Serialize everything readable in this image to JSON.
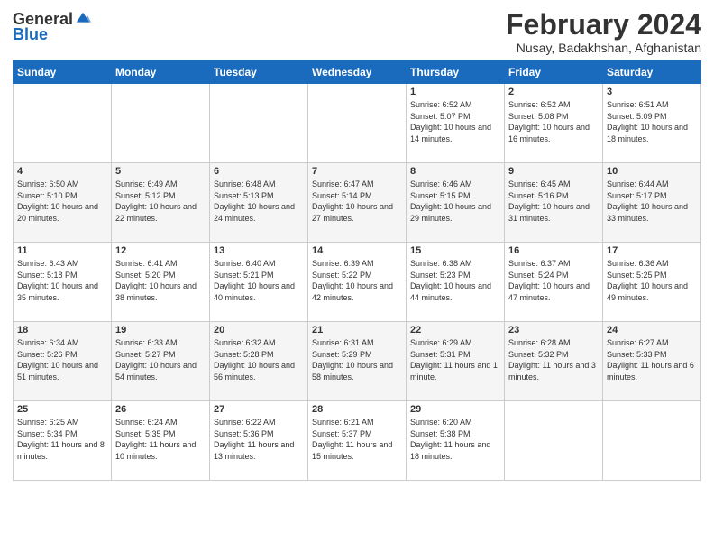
{
  "header": {
    "logo_general": "General",
    "logo_blue": "Blue",
    "month_year": "February 2024",
    "location": "Nusay, Badakhshan, Afghanistan"
  },
  "days_of_week": [
    "Sunday",
    "Monday",
    "Tuesday",
    "Wednesday",
    "Thursday",
    "Friday",
    "Saturday"
  ],
  "weeks": [
    [
      {
        "day": "",
        "info": ""
      },
      {
        "day": "",
        "info": ""
      },
      {
        "day": "",
        "info": ""
      },
      {
        "day": "",
        "info": ""
      },
      {
        "day": "1",
        "info": "Sunrise: 6:52 AM\nSunset: 5:07 PM\nDaylight: 10 hours and 14 minutes."
      },
      {
        "day": "2",
        "info": "Sunrise: 6:52 AM\nSunset: 5:08 PM\nDaylight: 10 hours and 16 minutes."
      },
      {
        "day": "3",
        "info": "Sunrise: 6:51 AM\nSunset: 5:09 PM\nDaylight: 10 hours and 18 minutes."
      }
    ],
    [
      {
        "day": "4",
        "info": "Sunrise: 6:50 AM\nSunset: 5:10 PM\nDaylight: 10 hours and 20 minutes."
      },
      {
        "day": "5",
        "info": "Sunrise: 6:49 AM\nSunset: 5:12 PM\nDaylight: 10 hours and 22 minutes."
      },
      {
        "day": "6",
        "info": "Sunrise: 6:48 AM\nSunset: 5:13 PM\nDaylight: 10 hours and 24 minutes."
      },
      {
        "day": "7",
        "info": "Sunrise: 6:47 AM\nSunset: 5:14 PM\nDaylight: 10 hours and 27 minutes."
      },
      {
        "day": "8",
        "info": "Sunrise: 6:46 AM\nSunset: 5:15 PM\nDaylight: 10 hours and 29 minutes."
      },
      {
        "day": "9",
        "info": "Sunrise: 6:45 AM\nSunset: 5:16 PM\nDaylight: 10 hours and 31 minutes."
      },
      {
        "day": "10",
        "info": "Sunrise: 6:44 AM\nSunset: 5:17 PM\nDaylight: 10 hours and 33 minutes."
      }
    ],
    [
      {
        "day": "11",
        "info": "Sunrise: 6:43 AM\nSunset: 5:18 PM\nDaylight: 10 hours and 35 minutes."
      },
      {
        "day": "12",
        "info": "Sunrise: 6:41 AM\nSunset: 5:20 PM\nDaylight: 10 hours and 38 minutes."
      },
      {
        "day": "13",
        "info": "Sunrise: 6:40 AM\nSunset: 5:21 PM\nDaylight: 10 hours and 40 minutes."
      },
      {
        "day": "14",
        "info": "Sunrise: 6:39 AM\nSunset: 5:22 PM\nDaylight: 10 hours and 42 minutes."
      },
      {
        "day": "15",
        "info": "Sunrise: 6:38 AM\nSunset: 5:23 PM\nDaylight: 10 hours and 44 minutes."
      },
      {
        "day": "16",
        "info": "Sunrise: 6:37 AM\nSunset: 5:24 PM\nDaylight: 10 hours and 47 minutes."
      },
      {
        "day": "17",
        "info": "Sunrise: 6:36 AM\nSunset: 5:25 PM\nDaylight: 10 hours and 49 minutes."
      }
    ],
    [
      {
        "day": "18",
        "info": "Sunrise: 6:34 AM\nSunset: 5:26 PM\nDaylight: 10 hours and 51 minutes."
      },
      {
        "day": "19",
        "info": "Sunrise: 6:33 AM\nSunset: 5:27 PM\nDaylight: 10 hours and 54 minutes."
      },
      {
        "day": "20",
        "info": "Sunrise: 6:32 AM\nSunset: 5:28 PM\nDaylight: 10 hours and 56 minutes."
      },
      {
        "day": "21",
        "info": "Sunrise: 6:31 AM\nSunset: 5:29 PM\nDaylight: 10 hours and 58 minutes."
      },
      {
        "day": "22",
        "info": "Sunrise: 6:29 AM\nSunset: 5:31 PM\nDaylight: 11 hours and 1 minute."
      },
      {
        "day": "23",
        "info": "Sunrise: 6:28 AM\nSunset: 5:32 PM\nDaylight: 11 hours and 3 minutes."
      },
      {
        "day": "24",
        "info": "Sunrise: 6:27 AM\nSunset: 5:33 PM\nDaylight: 11 hours and 6 minutes."
      }
    ],
    [
      {
        "day": "25",
        "info": "Sunrise: 6:25 AM\nSunset: 5:34 PM\nDaylight: 11 hours and 8 minutes."
      },
      {
        "day": "26",
        "info": "Sunrise: 6:24 AM\nSunset: 5:35 PM\nDaylight: 11 hours and 10 minutes."
      },
      {
        "day": "27",
        "info": "Sunrise: 6:22 AM\nSunset: 5:36 PM\nDaylight: 11 hours and 13 minutes."
      },
      {
        "day": "28",
        "info": "Sunrise: 6:21 AM\nSunset: 5:37 PM\nDaylight: 11 hours and 15 minutes."
      },
      {
        "day": "29",
        "info": "Sunrise: 6:20 AM\nSunset: 5:38 PM\nDaylight: 11 hours and 18 minutes."
      },
      {
        "day": "",
        "info": ""
      },
      {
        "day": "",
        "info": ""
      }
    ]
  ]
}
